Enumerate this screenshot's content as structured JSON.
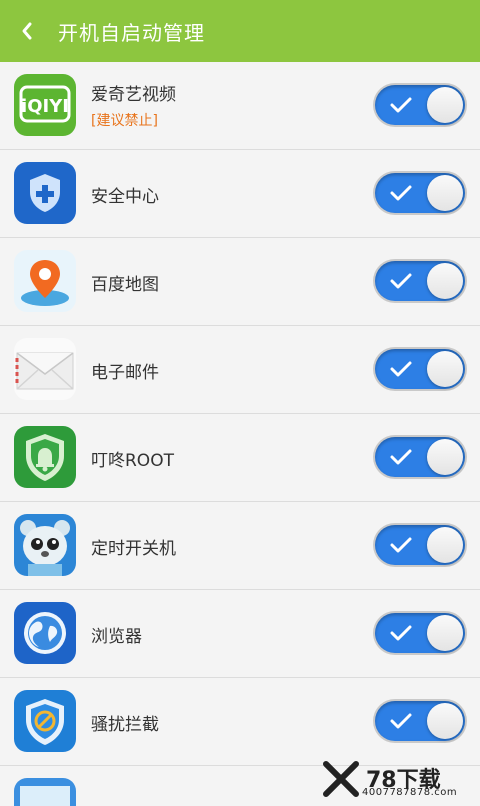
{
  "header": {
    "title": "开机自启动管理"
  },
  "apps": [
    {
      "name": "爱奇艺视频",
      "note": "[建议禁止]",
      "icon": "iqiyi-icon",
      "enabled": true
    },
    {
      "name": "安全中心",
      "note": "",
      "icon": "security-shield-icon",
      "enabled": true
    },
    {
      "name": "百度地图",
      "note": "",
      "icon": "map-pin-icon",
      "enabled": true
    },
    {
      "name": "电子邮件",
      "note": "",
      "icon": "envelope-icon",
      "enabled": true
    },
    {
      "name": "叮咚ROOT",
      "note": "",
      "icon": "bell-shield-icon",
      "enabled": true
    },
    {
      "name": "定时开关机",
      "note": "",
      "icon": "bear-icon",
      "enabled": true
    },
    {
      "name": "浏览器",
      "note": "",
      "icon": "globe-icon",
      "enabled": true
    },
    {
      "name": "骚扰拦截",
      "note": "",
      "icon": "block-shield-icon",
      "enabled": true
    }
  ],
  "watermark": {
    "brand": "78下载",
    "url": "4007787878.com"
  },
  "colors": {
    "header": "#8dc63f",
    "toggle_on": "#2d7fe5",
    "warning": "#e8741c"
  }
}
